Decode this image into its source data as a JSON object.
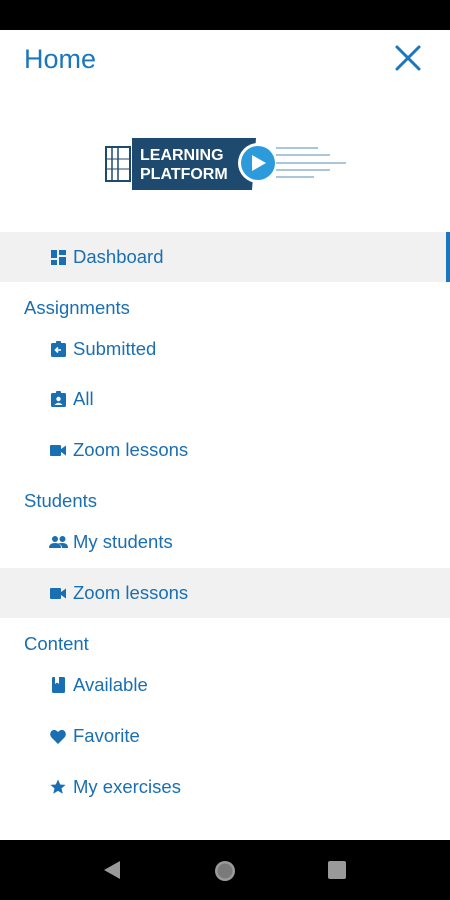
{
  "header": {
    "title": "Home"
  },
  "logo": {
    "line1": "LEARNING",
    "line2": "PLATFORM"
  },
  "menu": {
    "dashboard": "Dashboard",
    "assignments": {
      "heading": "Assignments",
      "submitted": "Submitted",
      "all": "All",
      "zoom": "Zoom lessons"
    },
    "students": {
      "heading": "Students",
      "my_students": "My students",
      "zoom": "Zoom lessons"
    },
    "content": {
      "heading": "Content",
      "available": "Available",
      "favorite": "Favorite",
      "my_exercises": "My exercises"
    }
  },
  "colors": {
    "accent": "#1a77bf",
    "logo_dark": "#1d4a6e",
    "logo_light": "#2c9bdc"
  }
}
